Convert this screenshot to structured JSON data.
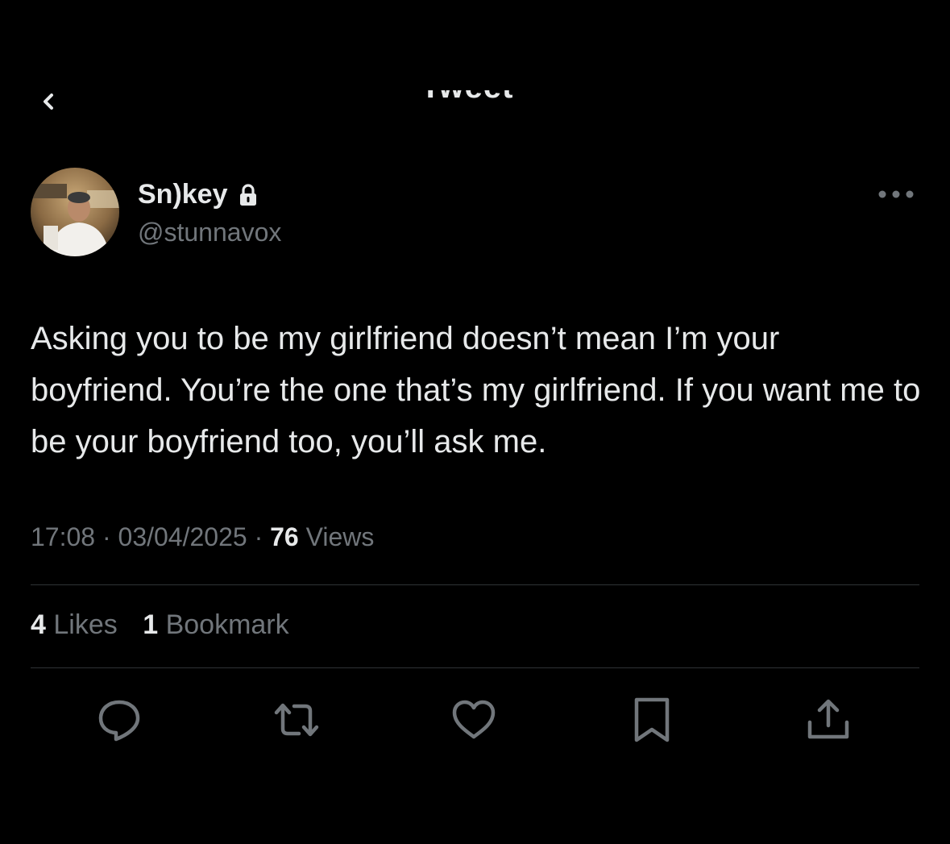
{
  "header": {
    "title": "Tweet",
    "back_icon": "chevron-left-icon"
  },
  "author": {
    "display_name": "Sn)key",
    "handle": "@stunnavox",
    "protected_icon": "lock-icon",
    "avatar": "avatar-photo"
  },
  "tweet": {
    "text": "Asking you to be my girlfriend doesn’t mean I’m your boyfriend. You’re the one that’s my girlfriend. If you want me to be your boyfriend too, you’ll ask me.",
    "time": "17:08",
    "date": "03/04/2025",
    "views_count": "76",
    "views_label": "Views",
    "separator": "·"
  },
  "stats": {
    "likes_count": "4",
    "likes_label": "Likes",
    "bookmarks_count": "1",
    "bookmarks_label": "Bookmark"
  },
  "actions": [
    {
      "name": "reply",
      "icon": "reply-icon"
    },
    {
      "name": "retweet",
      "icon": "retweet-icon"
    },
    {
      "name": "like",
      "icon": "heart-icon"
    },
    {
      "name": "bookmark",
      "icon": "bookmark-icon"
    },
    {
      "name": "share",
      "icon": "share-icon"
    }
  ],
  "colors": {
    "background": "#000000",
    "primary_text": "#e7e9ea",
    "secondary_text": "#71767b",
    "divider": "#2f3336"
  }
}
